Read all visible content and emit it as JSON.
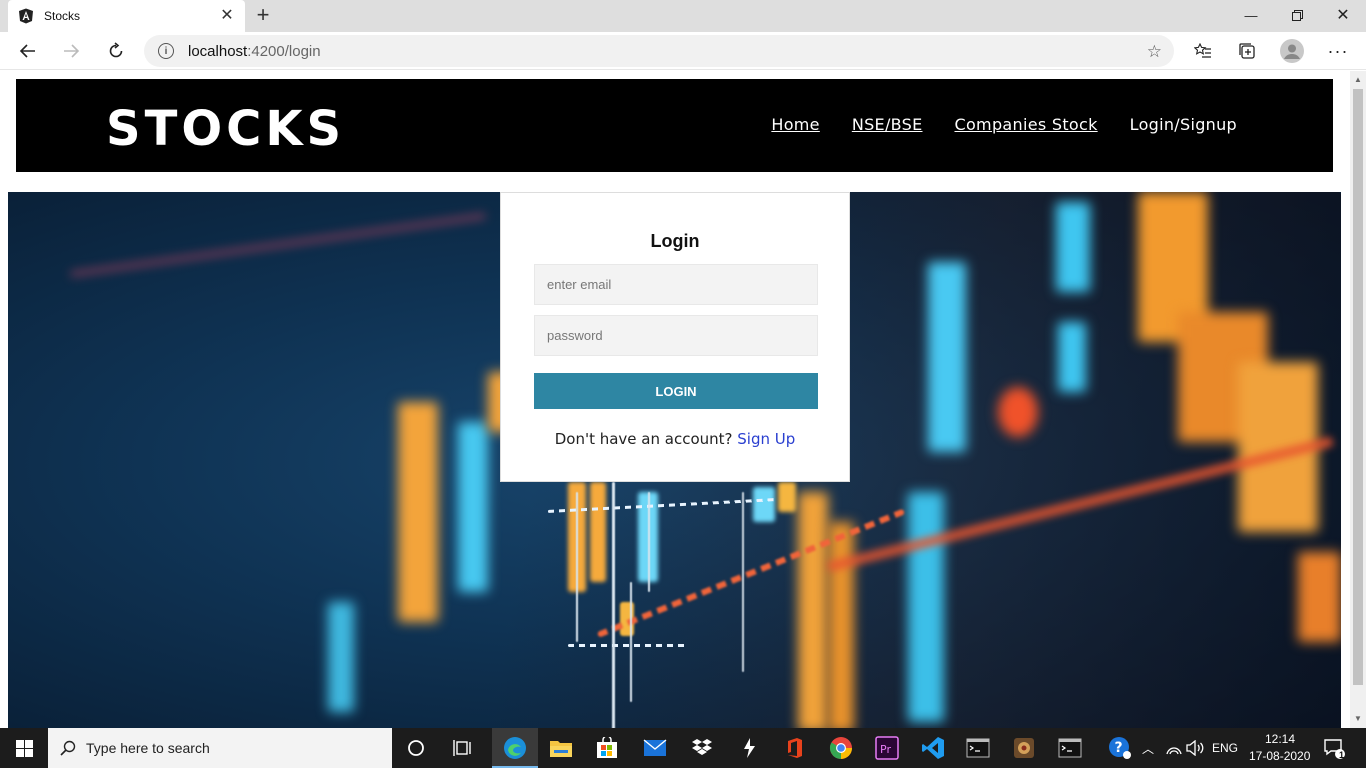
{
  "browser": {
    "tab_title": "Stocks",
    "url_prefix": "localhost",
    "url_rest": ":4200/login"
  },
  "site": {
    "logo": "STOCKS",
    "nav": [
      "Home",
      "NSE/BSE",
      "Companies Stock",
      "Login/Signup"
    ]
  },
  "login": {
    "title": "Login",
    "email_placeholder": "enter email",
    "password_placeholder": "password",
    "button_label": "LOGIN",
    "signup_prompt": "Don't have an account?",
    "signup_link": "Sign Up"
  },
  "taskbar": {
    "search_placeholder": "Type here to search",
    "language": "ENG",
    "time": "12:14",
    "date": "17-08-2020",
    "notification_count": "1"
  },
  "colors": {
    "login_button": "#2e86a3",
    "signup_link": "#2a3fd0",
    "header_bg": "#000000"
  }
}
